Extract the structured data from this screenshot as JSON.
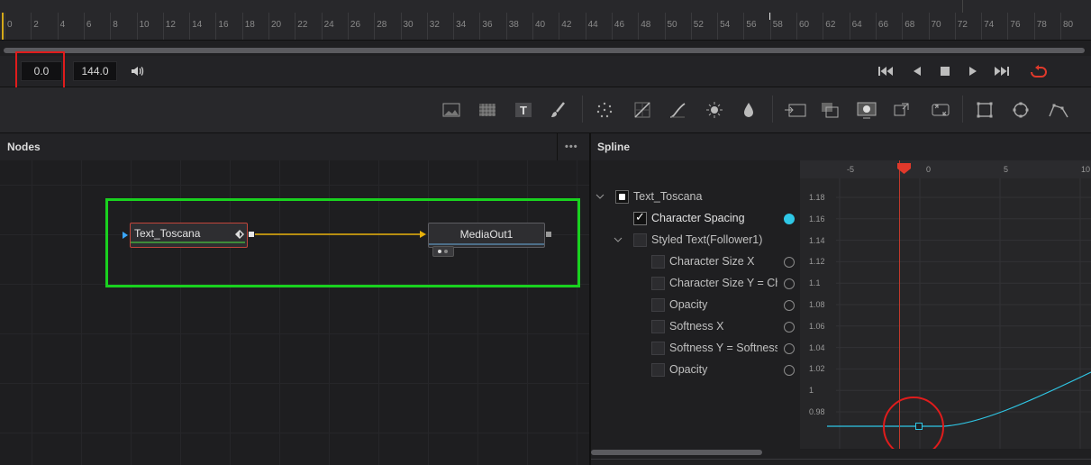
{
  "ruler": {
    "labels": [
      "0",
      "2",
      "4",
      "6",
      "8",
      "10",
      "12",
      "14",
      "16",
      "18",
      "20",
      "22",
      "24",
      "26",
      "28",
      "30",
      "32",
      "34",
      "36",
      "38",
      "40",
      "42",
      "44",
      "46",
      "48",
      "50",
      "52",
      "54",
      "56",
      "58",
      "60",
      "62",
      "64",
      "66",
      "68",
      "70",
      "72",
      "74",
      "76",
      "78",
      "80"
    ]
  },
  "transport": {
    "current_time": "0.0",
    "end_time": "144.0",
    "icons": [
      "volume-icon",
      "jump-start-icon",
      "play-reverse-icon",
      "stop-icon",
      "play-icon",
      "jump-end-icon",
      "loop-icon"
    ],
    "loop_color": "#e0392b"
  },
  "toolbar": {
    "icons": [
      "background-icon",
      "fastnoise-icon",
      "text-icon",
      "paint-icon",
      "particles-icon",
      "color-curves-icon",
      "brightness-contrast-icon",
      "glow-icon",
      "blur-icon",
      "merge-icon",
      "channel-booleans-icon",
      "matte-control-icon",
      "transform-icon",
      "resize-icon",
      "rectangle-mask-icon",
      "ellipse-mask-icon",
      "polygon-mask-icon"
    ],
    "text_glyph": "T"
  },
  "nodes_panel": {
    "title": "Nodes",
    "menu_glyph": "•••",
    "node1": {
      "label": "Text_Toscana"
    },
    "node2": {
      "label": "MediaOut1"
    },
    "connection_color": "#e7b10b",
    "highlight_color": "#19d11f"
  },
  "spline_panel": {
    "title": "Spline",
    "tree": [
      {
        "label": "Text_Toscana"
      },
      {
        "label": "Character Spacing",
        "checked_glyph": "✓"
      },
      {
        "label": "Styled Text(Follower1)"
      },
      {
        "label": "Character Size X"
      },
      {
        "label": "Character Size Y = Character Size X"
      },
      {
        "label": "Opacity"
      },
      {
        "label": "Softness X"
      },
      {
        "label": "Softness Y = Softness X"
      },
      {
        "label": "Opacity"
      }
    ],
    "graph": {
      "x_labels": [
        "-5",
        "0",
        "5",
        "10"
      ],
      "y_labels": [
        "1.18",
        "1.16",
        "1.14",
        "1.12",
        "1.1",
        "1.08",
        "1.06",
        "1.04",
        "1.02",
        "1",
        "0.98"
      ],
      "curve_color": "#2fc7e6",
      "playhead_color": "#e0392b"
    }
  }
}
